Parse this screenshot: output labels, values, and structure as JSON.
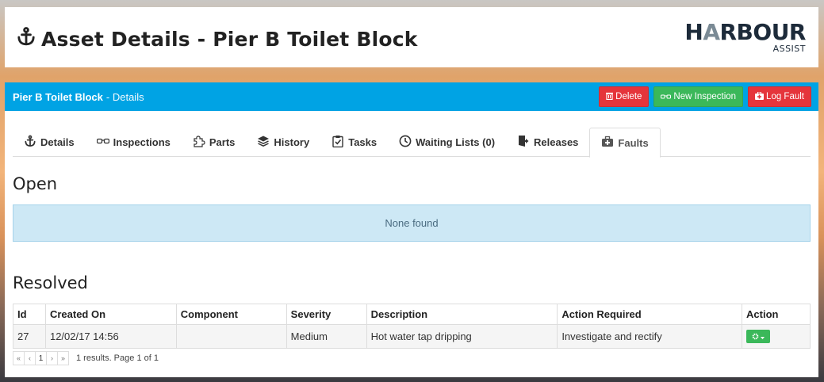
{
  "header": {
    "title": "Asset Details - Pier B Toilet Block",
    "logo_main_left": "H",
    "logo_main_mid": "A",
    "logo_main_right": "RBOUR",
    "logo_sub": "ASSIST"
  },
  "panel": {
    "crumb_main": "Pier B Toilet Block",
    "crumb_sub": "- Details",
    "buttons": {
      "delete": "Delete",
      "new_inspection": "New Inspection",
      "log_fault": "Log Fault"
    }
  },
  "tabs": [
    {
      "label": "Details",
      "icon": "anchor-icon"
    },
    {
      "label": "Inspections",
      "icon": "glasses-icon"
    },
    {
      "label": "Parts",
      "icon": "puzzle-icon"
    },
    {
      "label": "History",
      "icon": "layers-icon"
    },
    {
      "label": "Tasks",
      "icon": "clipboard-check-icon"
    },
    {
      "label": "Waiting Lists (0)",
      "icon": "clock-icon"
    },
    {
      "label": "Releases",
      "icon": "exit-door-icon"
    },
    {
      "label": "Faults",
      "icon": "medkit-icon",
      "active": true
    }
  ],
  "open": {
    "title": "Open",
    "empty_text": "None found"
  },
  "resolved": {
    "title": "Resolved",
    "columns": [
      "Id",
      "Created On",
      "Component",
      "Severity",
      "Description",
      "Action Required",
      "Action"
    ],
    "rows": [
      {
        "id": "27",
        "created_on": "12/02/17 14:56",
        "component": "",
        "severity": "Medium",
        "description": "Hot water tap dripping",
        "action_required": "Investigate and rectify"
      }
    ]
  },
  "pager": {
    "first": "«",
    "prev": "‹",
    "page": "1",
    "next": "›",
    "last": "»",
    "info_prefix": "1 results. Page ",
    "current_page": "1",
    "info_mid": " of ",
    "total_pages": "1"
  },
  "colors": {
    "panel_heading": "#00a3e4",
    "danger": "#e5353b",
    "success": "#3bb85a",
    "info_bg": "#cde8f5"
  }
}
